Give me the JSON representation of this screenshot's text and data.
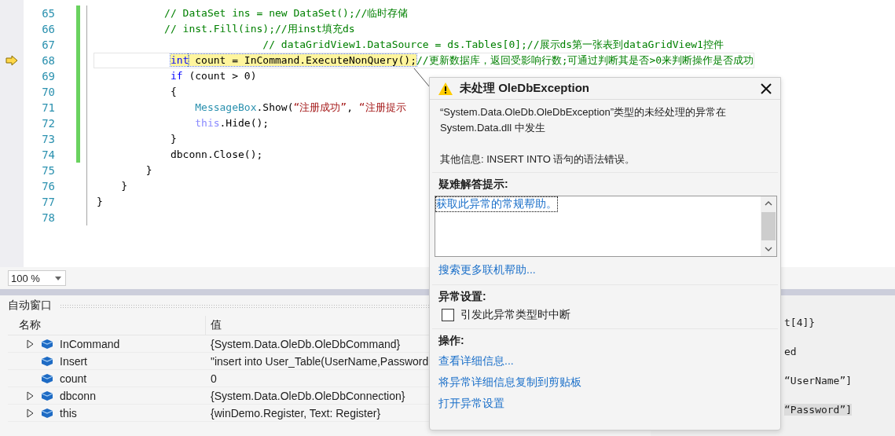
{
  "editor": {
    "lines": [
      {
        "number": "65",
        "current": false,
        "changed": true,
        "tokens": [
          {
            "kind": "comment",
            "text": "           // DataSet ins = new DataSet();//临时存储"
          }
        ]
      },
      {
        "number": "66",
        "current": false,
        "changed": true,
        "tokens": [
          {
            "kind": "comment",
            "text": "           // inst.Fill(ins);//用inst填充ds"
          }
        ]
      },
      {
        "number": "67",
        "current": false,
        "changed": true,
        "tokens": [
          {
            "kind": "comment",
            "text": "                           // dataGridView1.DataSource = ds.Tables[0];//展示ds第一张表到dataGridView1控件"
          }
        ]
      },
      {
        "number": "68",
        "current": true,
        "changed": true,
        "tokens": [
          {
            "kind": "keyword",
            "text": "            int"
          },
          {
            "kind": "plain",
            "text": " count = InCommand.ExecuteNonQuery();"
          },
          {
            "kind": "comment",
            "text": "//更新数据库，返回受影响行数;可通过判断其是否>0来判断操作是否成功"
          }
        ]
      },
      {
        "number": "69",
        "current": false,
        "changed": true,
        "tokens": [
          {
            "kind": "keyword",
            "text": "            if"
          },
          {
            "kind": "plain",
            "text": " (count > 0)"
          }
        ]
      },
      {
        "number": "70",
        "current": false,
        "changed": true,
        "tokens": [
          {
            "kind": "plain",
            "text": "            {"
          }
        ]
      },
      {
        "number": "71",
        "current": false,
        "changed": true,
        "tokens": [
          {
            "kind": "type",
            "text": "                MessageBox"
          },
          {
            "kind": "plain",
            "text": ".Show("
          },
          {
            "kind": "string",
            "text": "“注册成功”"
          },
          {
            "kind": "plain",
            "text": ", "
          },
          {
            "kind": "string",
            "text": "“注册提示"
          }
        ]
      },
      {
        "number": "72",
        "current": false,
        "changed": true,
        "tokens": [
          {
            "kind": "this",
            "text": "                this"
          },
          {
            "kind": "plain",
            "text": ".Hide();"
          }
        ]
      },
      {
        "number": "73",
        "current": false,
        "changed": true,
        "tokens": [
          {
            "kind": "plain",
            "text": "            }"
          }
        ]
      },
      {
        "number": "74",
        "current": false,
        "changed": true,
        "tokens": [
          {
            "kind": "plain",
            "text": "            dbconn.Close();"
          }
        ]
      },
      {
        "number": "75",
        "current": false,
        "changed": false,
        "tokens": [
          {
            "kind": "plain",
            "text": "        }"
          }
        ]
      },
      {
        "number": "76",
        "current": false,
        "changed": false,
        "tokens": [
          {
            "kind": "plain",
            "text": "    }"
          }
        ]
      },
      {
        "number": "77",
        "current": false,
        "changed": false,
        "tokens": [
          {
            "kind": "plain",
            "text": "}"
          }
        ]
      },
      {
        "number": "78",
        "current": false,
        "changed": false
      }
    ]
  },
  "zoom": {
    "value": "100 %"
  },
  "autos": {
    "title": "自动窗口",
    "columns": [
      "名称",
      "值"
    ],
    "rows": [
      {
        "name": "InCommand",
        "value": "{System.Data.OleDb.OleDbCommand}",
        "expandable": true
      },
      {
        "name": "Insert",
        "value": "\"insert into User_Table(UserName,Password",
        "expandable": false
      },
      {
        "name": "count",
        "value": "0",
        "expandable": false
      },
      {
        "name": "dbconn",
        "value": "{System.Data.OleDb.OleDbConnection}",
        "expandable": true
      },
      {
        "name": "this",
        "value": "{winDemo.Register, Text: Register}",
        "expandable": true
      }
    ]
  },
  "side_panel": {
    "lines": [
      {
        "text": "t[4]}",
        "selected": false
      },
      {
        "text": "ed",
        "selected": false
      },
      {
        "text": "“UserName”]",
        "selected": false
      },
      {
        "text": "“Password”]",
        "selected": true
      }
    ]
  },
  "exception": {
    "title": "未处理 OleDbException",
    "message": "“System.Data.OleDb.OleDbException”类型的未经处理的异常在 System.Data.dll 中发生",
    "additional_info": "其他信息: INSERT INTO 语句的语法错误。",
    "troubleshooting_label": "疑难解答提示:",
    "tips": [
      {
        "text": "获取此异常的常规帮助。",
        "selected": true
      }
    ],
    "search_link": "搜索更多联机帮助...",
    "settings_label": "异常设置:",
    "checkbox": {
      "label": "引发此异常类型时中断",
      "checked": false
    },
    "actions_label": "操作:",
    "actions": [
      "查看详细信息...",
      "将异常详细信息复制到剪贴板",
      "打开异常设置"
    ]
  }
}
